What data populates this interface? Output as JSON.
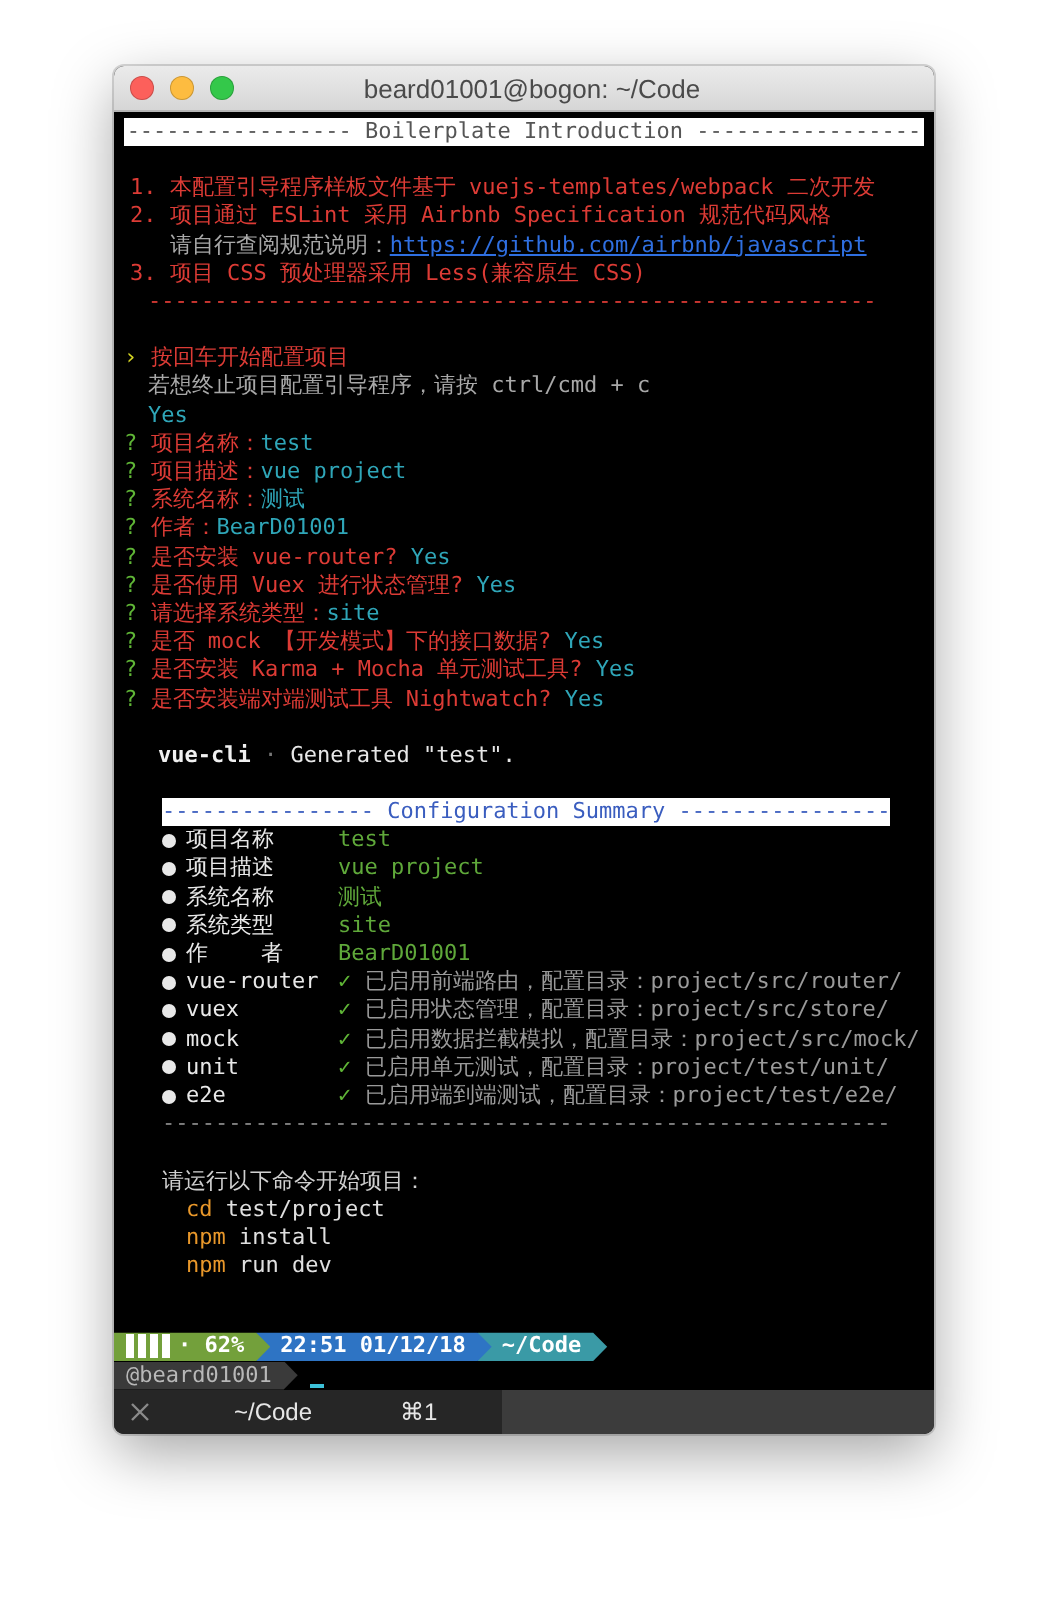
{
  "window": {
    "title": "beard01001@bogon: ~/Code"
  },
  "intro": {
    "banner": "----------------- Boilerplate Introduction -----------------",
    "lines": [
      {
        "segments": [
          {
            "kind": "notice",
            "text": "1. 本配置引导程序样板文件基于 vuejs-templates/webpack 二次开发"
          }
        ]
      },
      {
        "segments": [
          {
            "kind": "notice",
            "text": "2. 项目通过 ESLint 采用 Airbnb Specification 规范代码风格"
          }
        ]
      },
      {
        "segments": [
          {
            "kind": "hint",
            "text": "   请自行查阅规范说明："
          },
          {
            "kind": "link",
            "text": "https://github.com/airbnb/javascript"
          }
        ]
      },
      {
        "segments": [
          {
            "kind": "notice",
            "text": "3. 项目 CSS 预处理器采用 Less(兼容原生 CSS)"
          }
        ]
      }
    ],
    "rule": "-------------------------------------------------------"
  },
  "prompts": {
    "pointer": "›",
    "start": "按回车开始配置项目",
    "hint": "若想终止项目配置引导程序，请按 ctrl/cmd + c",
    "confirm": "Yes",
    "questions": [
      {
        "mark": "?",
        "question": "项目名称：",
        "answer": "test"
      },
      {
        "mark": "?",
        "question": "项目描述：",
        "answer": "vue project"
      },
      {
        "mark": "?",
        "question": "系统名称：",
        "answer": "测试"
      },
      {
        "mark": "?",
        "question": "作者：",
        "answer": "BearD01001"
      },
      {
        "mark": "?",
        "question": "是否安装 vue-router? ",
        "answer": "Yes"
      },
      {
        "mark": "?",
        "question": "是否使用 Vuex 进行状态管理? ",
        "answer": "Yes"
      },
      {
        "mark": "?",
        "question": "请选择系统类型：",
        "answer": "site"
      },
      {
        "mark": "?",
        "question": "是否 mock 【开发模式】下的接口数据? ",
        "answer": "Yes"
      },
      {
        "mark": "?",
        "question": "是否安装 Karma + Mocha 单元测试工具? ",
        "answer": "Yes"
      },
      {
        "mark": "?",
        "question": "是否安装端对端测试工具 Nightwatch? ",
        "answer": "Yes"
      }
    ]
  },
  "generated": {
    "tool": "vue-cli",
    "separator": "·",
    "message": "Generated \"test\"."
  },
  "summary": {
    "banner": "---------------- Configuration Summary ----------------",
    "rows": [
      {
        "kind": "value",
        "label": "项目名称",
        "value": "test"
      },
      {
        "kind": "value",
        "label": "项目描述",
        "value": "vue project"
      },
      {
        "kind": "value",
        "label": "系统名称",
        "value": "测试"
      },
      {
        "kind": "value",
        "label": "系统类型",
        "value": "site"
      },
      {
        "kind": "value",
        "label": "作    者",
        "value": "BearD01001"
      },
      {
        "kind": "feature",
        "label": "vue-router",
        "check": "✓",
        "note": "已启用前端路由，配置目录：project/src/router/"
      },
      {
        "kind": "feature",
        "label": "vuex",
        "check": "✓",
        "note": "已启用状态管理，配置目录：project/src/store/"
      },
      {
        "kind": "feature",
        "label": "mock",
        "check": "✓",
        "note": "已启用数据拦截模拟，配置目录：project/src/mock/"
      },
      {
        "kind": "feature",
        "label": "unit",
        "check": "✓",
        "note": "已启用单元测试，配置目录：project/test/unit/"
      },
      {
        "kind": "feature",
        "label": "e2e",
        "check": "✓",
        "note": "已启用端到端测试，配置目录：project/test/e2e/"
      }
    ],
    "rule": "-------------------------------------------------------"
  },
  "instructions": {
    "title": "请运行以下命令开始项目：",
    "commands": [
      {
        "command": "cd",
        "args": "test/project"
      },
      {
        "command": "npm",
        "args": "install"
      },
      {
        "command": "npm",
        "args": "run dev"
      }
    ]
  },
  "status_bar": {
    "segments": [
      {
        "kind": "battery",
        "text": "· 62%"
      },
      {
        "kind": "clock",
        "text": "22:51 01/12/18"
      },
      {
        "kind": "path",
        "text": "~/Code"
      }
    ]
  },
  "prompt": {
    "user": "@beard01001"
  },
  "tab_bar": {
    "tabs": [
      {
        "title": "~/Code",
        "shortcut": "⌘1",
        "selected": true
      }
    ]
  }
}
